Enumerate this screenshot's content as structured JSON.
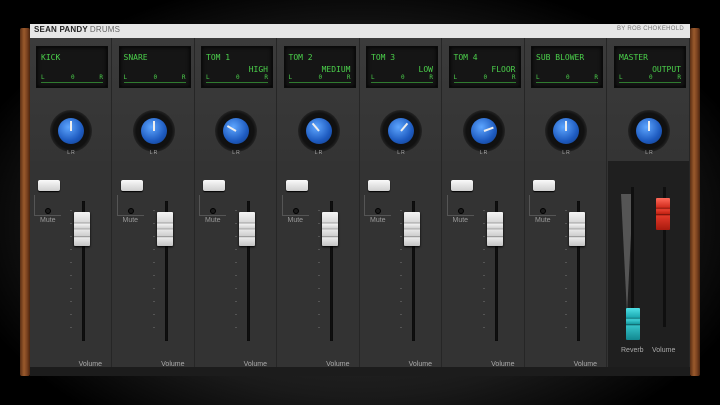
{
  "header": {
    "brand": "SEAN PANDY",
    "brand_sub": "DRUMS",
    "credit": "BY ROB CHOKEHOLD"
  },
  "channels": [
    {
      "line1": "KICK",
      "line2": "",
      "pan_l": "L",
      "pan_c": "0",
      "pan_r": "R",
      "knob": "L R",
      "volume": "Volume",
      "mute": "Mute"
    },
    {
      "line1": "SNARE",
      "line2": "",
      "pan_l": "L",
      "pan_c": "0",
      "pan_r": "R",
      "knob": "L R",
      "volume": "Volume",
      "mute": "Mute"
    },
    {
      "line1": "TOM 1",
      "line2": "HIGH",
      "pan_l": "L",
      "pan_c": "0",
      "pan_r": "R",
      "knob": "L R",
      "volume": "Volume",
      "mute": "Mute"
    },
    {
      "line1": "TOM 2",
      "line2": "MEDIUM",
      "pan_l": "L",
      "pan_c": "0",
      "pan_r": "R",
      "knob": "L R",
      "volume": "Volume",
      "mute": "Mute"
    },
    {
      "line1": "TOM 3",
      "line2": "LOW",
      "pan_l": "L",
      "pan_c": "0",
      "pan_r": "R",
      "knob": "L R",
      "volume": "Volume",
      "mute": "Mute"
    },
    {
      "line1": "TOM 4",
      "line2": "FLOOR",
      "pan_l": "L",
      "pan_c": "0",
      "pan_r": "R",
      "knob": "L R",
      "volume": "Volume",
      "mute": "Mute"
    },
    {
      "line1": "SUB BLOWER",
      "line2": "",
      "pan_l": "L",
      "pan_c": "0",
      "pan_r": "R",
      "knob": "L R",
      "volume": "Volume",
      "mute": "Mute"
    }
  ],
  "master": {
    "line1": "MASTER",
    "line2": "OUTPUT",
    "pan_l": "L",
    "pan_c": "0",
    "pan_r": "R",
    "knob": "L R",
    "reverb": "Reverb",
    "volume": "Volume"
  },
  "colors": {
    "lcd_text": "#4bd04b",
    "knob": "#1e5bc0",
    "reverb_fader": "#1aa8b0",
    "master_fader": "#d02a1c"
  },
  "icons": {
    "knob": "pan-knob-icon",
    "fader": "fader-icon"
  }
}
